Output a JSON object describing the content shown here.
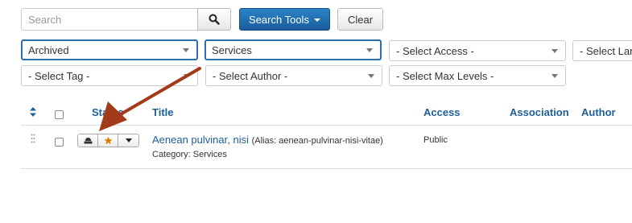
{
  "search": {
    "placeholder": "Search"
  },
  "toolbar": {
    "search_tools_label": "Search Tools",
    "clear_label": "Clear"
  },
  "filters": {
    "state": "Archived",
    "category": "Services",
    "access": "- Select Access -",
    "language": "- Select Language -",
    "tag": "- Select Tag -",
    "author": "- Select Author -",
    "max_levels": "- Select Max Levels -"
  },
  "table": {
    "headers": {
      "status": "Status",
      "title": "Title",
      "access": "Access",
      "association": "Association",
      "author": "Author"
    },
    "rows": [
      {
        "title": "Aenean pulvinar, nisi",
        "alias": "(Alias: aenean-pulvinar-nisi-vitae)",
        "category": "Category: Services",
        "access": "Public",
        "status_icon": "archive-icon",
        "featured_icon": "star-icon"
      }
    ]
  },
  "colors": {
    "primary": "#1d5f9a",
    "search_tools_button": "#1a5c9c",
    "annotation_arrow": "#a33a1a",
    "star": "#e07b00"
  }
}
